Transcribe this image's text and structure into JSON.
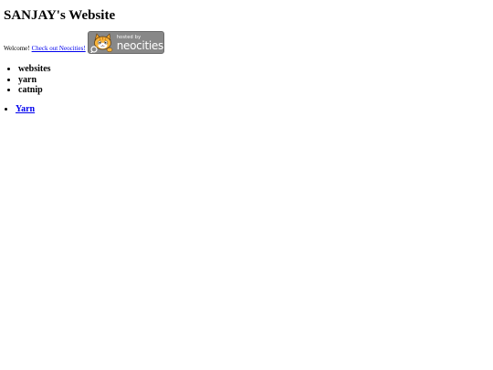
{
  "site": {
    "title": "SANJAY's Website"
  },
  "welcome": {
    "text": "Welcome!",
    "link_label": "Check out Neocities!"
  },
  "badge": {
    "hosted_by": "hosted by",
    "brand": "neocities",
    "icon": "neocities-cat-logo",
    "background": "#888888"
  },
  "topics": [
    {
      "label": "websites"
    },
    {
      "label": "yarn"
    },
    {
      "label": "catnip"
    }
  ],
  "links": [
    {
      "label": "Yarn"
    }
  ],
  "colors": {
    "link": "#0000ee",
    "text": "#000000",
    "background": "#ffffff"
  }
}
